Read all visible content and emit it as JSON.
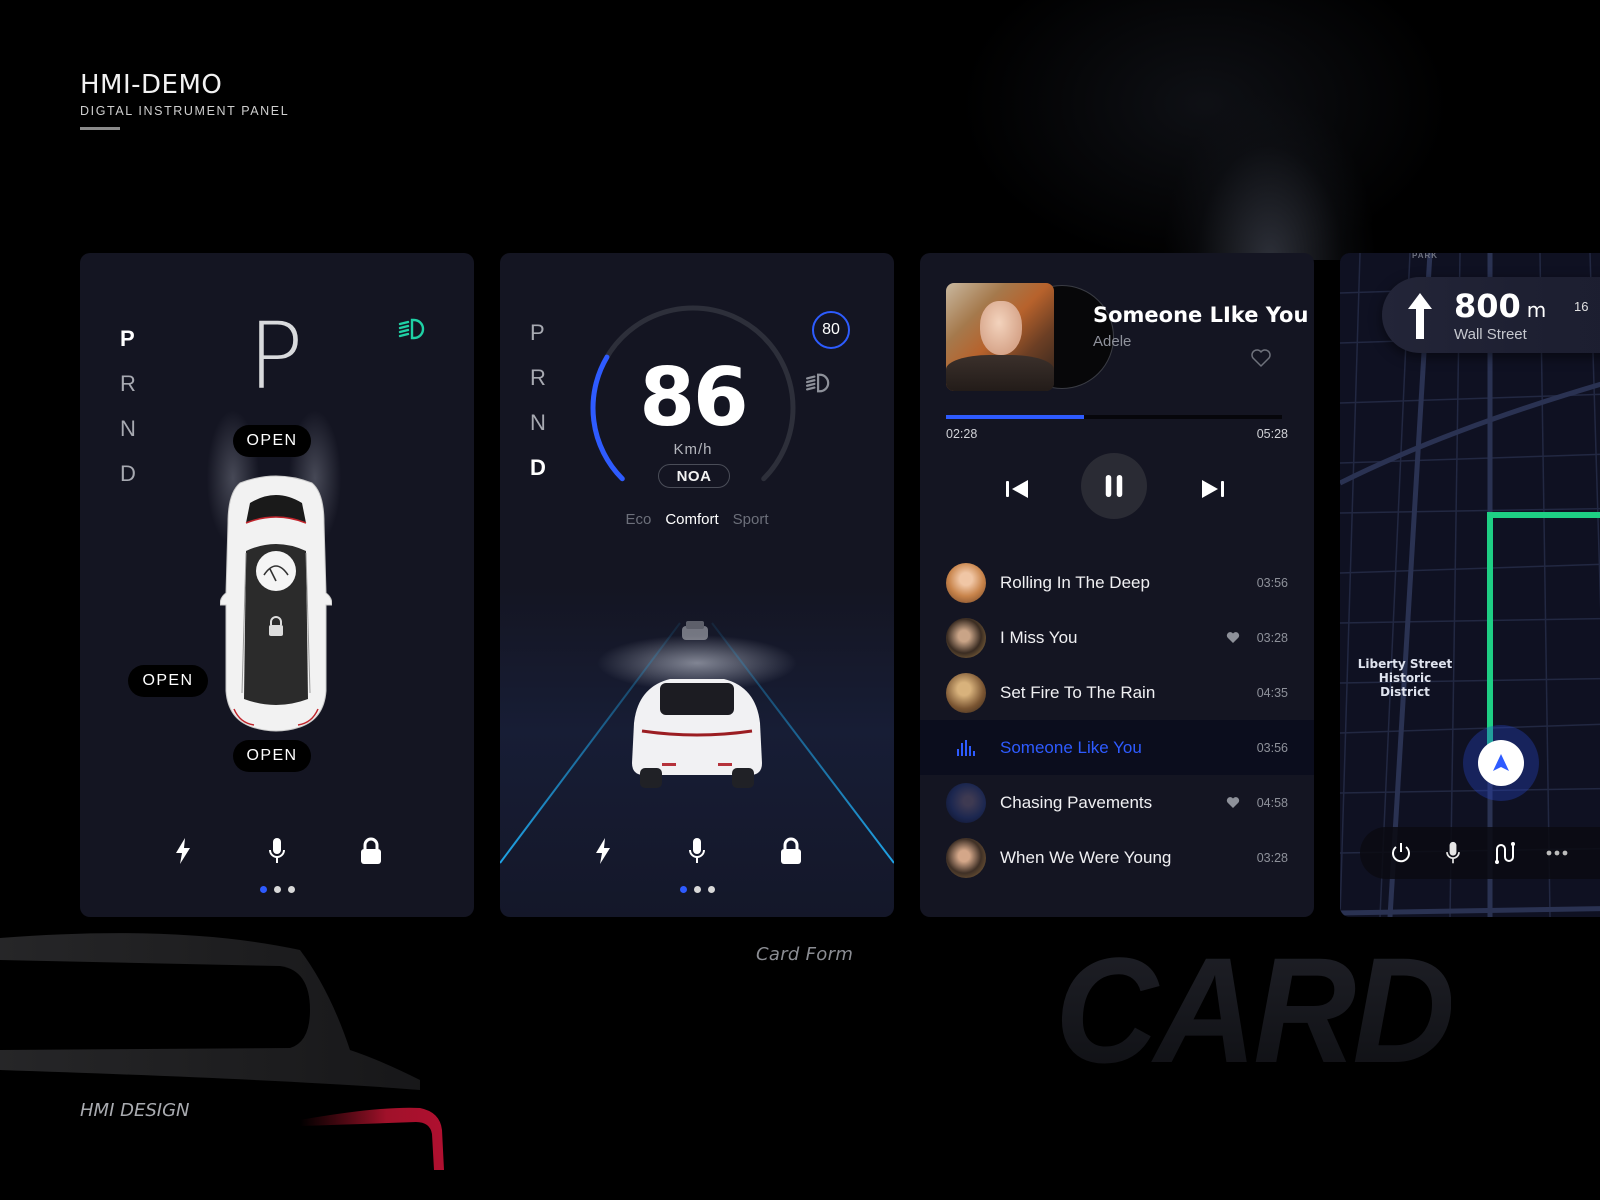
{
  "brand": {
    "title": "HMI-DEMO",
    "subtitle": "DIGTAL  INSTRUMENT  PANEL"
  },
  "vehicle_card": {
    "gears": [
      "P",
      "R",
      "N",
      "D"
    ],
    "active_gear": "P",
    "gear_display": "P",
    "headlight_color": "#1fd1a5",
    "door_labels": {
      "front": "OPEN",
      "left": "OPEN",
      "rear": "OPEN"
    },
    "car_icons": [
      "wiper-icon",
      "lock-icon"
    ],
    "bottom_icons": [
      "lightning-icon",
      "microphone-icon",
      "lock-icon"
    ],
    "page_dots": {
      "count": 3,
      "active_index": 0
    }
  },
  "drive_card": {
    "gears": [
      "P",
      "R",
      "N",
      "D"
    ],
    "active_gear": "D",
    "speed": "86",
    "speed_unit": "Km/h",
    "speed_fraction": 0.28,
    "assist_mode": "NOA",
    "speed_limit": "80",
    "modes": [
      "Eco",
      "Comfort",
      "Sport"
    ],
    "active_mode": "Comfort",
    "bottom_icons": [
      "lightning-icon",
      "microphone-icon",
      "lock-icon"
    ],
    "page_dots": {
      "count": 3,
      "active_index": 0
    }
  },
  "music_card": {
    "now_playing": {
      "title": "Someone LIke You",
      "artist": "Adele",
      "elapsed": "02:28",
      "total": "05:28",
      "progress_fraction": 0.41,
      "liked": false
    },
    "controls": [
      "previous-track",
      "pause",
      "next-track"
    ],
    "playlist": [
      {
        "title": "Rolling In The Deep",
        "duration": "03:56",
        "liked": false,
        "current": false
      },
      {
        "title": "I Miss You",
        "duration": "03:28",
        "liked": true,
        "current": false
      },
      {
        "title": "Set Fire To The Rain",
        "duration": "04:35",
        "liked": false,
        "current": false
      },
      {
        "title": "Someone Like You",
        "duration": "03:56",
        "liked": false,
        "current": true
      },
      {
        "title": "Chasing Pavements",
        "duration": "04:58",
        "liked": true,
        "current": false
      },
      {
        "title": "When We Were Young",
        "duration": "03:28",
        "liked": false,
        "current": false
      }
    ],
    "accent_color": "#2e5bff"
  },
  "nav_card": {
    "map_label_park": "PARK",
    "distance": "800",
    "distance_unit": "m",
    "street": "Wall Street",
    "eta_partial": "16",
    "poi_label": [
      "Liberty Street",
      "Historic",
      "District"
    ],
    "route_color": "#1ecf84",
    "bottom_icons": [
      "power-icon",
      "microphone-icon",
      "route-icon",
      "more-icon"
    ]
  },
  "footer": {
    "caption": "Card Form",
    "watermark": "CARD",
    "design_label": "HMI DESIGN"
  }
}
